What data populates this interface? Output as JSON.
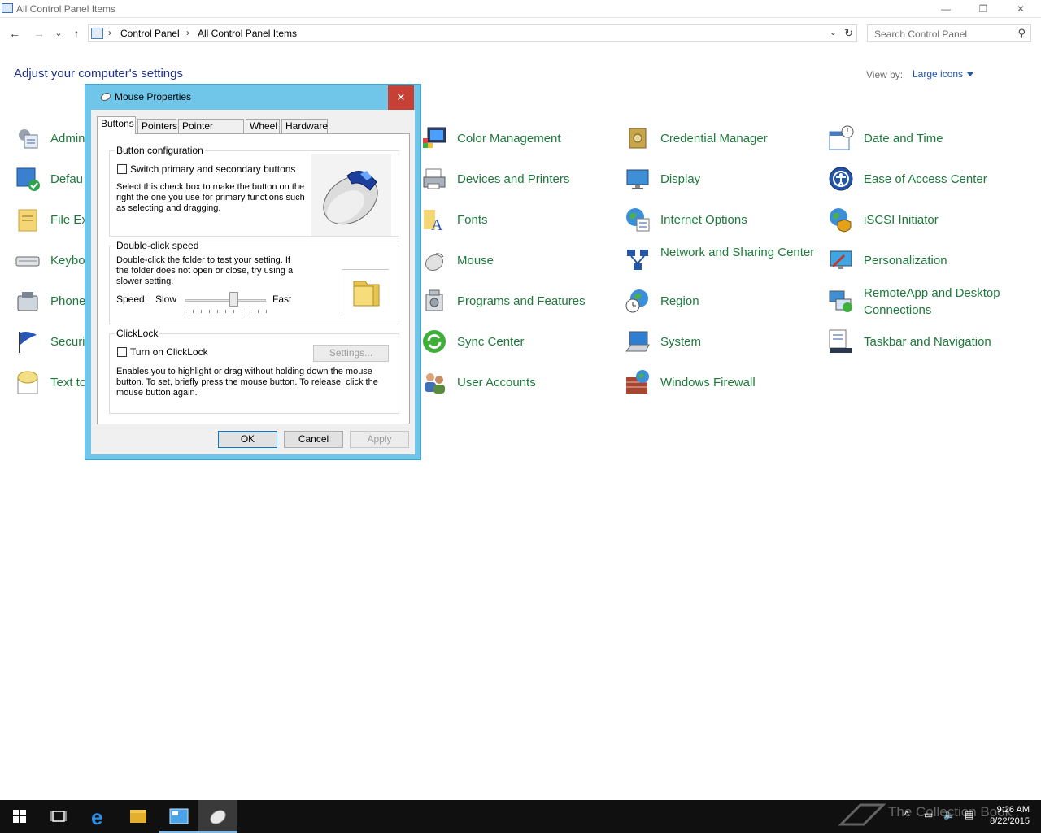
{
  "window": {
    "title": "All Control Panel Items",
    "controls": {
      "minimize": "—",
      "restore": "❐",
      "close": "✕"
    }
  },
  "nav": {
    "back": "←",
    "forward": "→",
    "recent": "⌄",
    "up": "↑"
  },
  "breadcrumb": [
    "Control Panel",
    "All Control Panel Items"
  ],
  "search": {
    "placeholder": "Search Control Panel"
  },
  "page": {
    "heading": "Adjust your computer's settings",
    "view_by_label": "View by:",
    "view_by_value": "Large icons"
  },
  "items": {
    "col1": [
      "Admin",
      "Defau",
      "File Ex",
      "Keybo",
      "Phone",
      "Securi",
      "Text to"
    ],
    "col2": [
      "Color Management",
      "Devices and Printers",
      "Fonts",
      "Mouse",
      "Programs and Features",
      "Sync Center",
      "User Accounts"
    ],
    "col3": [
      "Credential Manager",
      "Display",
      "Internet Options",
      "Network and Sharing Center",
      "Region",
      "System",
      "Windows Firewall"
    ],
    "col4": [
      "Date and Time",
      "Ease of Access Center",
      "iSCSI Initiator",
      "Personalization",
      "RemoteApp and Desktop Connections",
      "Taskbar and Navigation"
    ]
  },
  "dialog": {
    "title": "Mouse Properties",
    "close": "✕",
    "tabs": [
      "Buttons",
      "Pointers",
      "Pointer Options",
      "Wheel",
      "Hardware"
    ],
    "button_config": {
      "title": "Button configuration",
      "checkbox_label": "Switch primary and secondary buttons",
      "description": "Select this check box to make the button on the right the one you use for primary functions such as selecting and dragging."
    },
    "double_click": {
      "title": "Double-click speed",
      "description": "Double-click the folder to test your setting. If the folder does not open or close, try using a slower setting.",
      "speed_label": "Speed:",
      "slow": "Slow",
      "fast": "Fast",
      "speed_value": 0.6
    },
    "clicklock": {
      "title": "ClickLock",
      "checkbox_label": "Turn on ClickLock",
      "settings_button": "Settings...",
      "description": "Enables you to highlight or drag without holding down the mouse button. To set, briefly press the mouse button. To release, click the mouse button again."
    },
    "buttons": {
      "ok": "OK",
      "cancel": "Cancel",
      "apply": "Apply"
    }
  },
  "taskbar": {
    "time": "9:26 AM",
    "date": "8/22/2015",
    "watermark": "The Collection Book"
  }
}
